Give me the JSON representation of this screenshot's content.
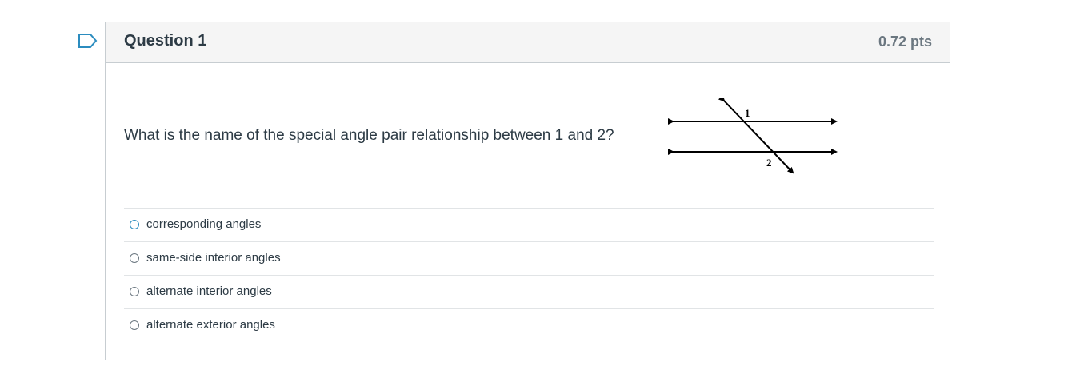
{
  "question": {
    "title": "Question 1",
    "points": "0.72 pts",
    "text": "What is the name of the special angle pair relationship between 1 and 2?",
    "diagram": {
      "angle_label_1": "1",
      "angle_label_2": "2"
    },
    "answers": [
      {
        "label": "corresponding angles",
        "selected": false
      },
      {
        "label": "same-side interior angles",
        "selected": false
      },
      {
        "label": "alternate interior angles",
        "selected": false
      },
      {
        "label": "alternate exterior angles",
        "selected": false
      }
    ]
  },
  "colors": {
    "header_bg": "#f5f5f5",
    "border": "#c7cdd1",
    "text": "#2d3b45",
    "points_text": "#6b7780",
    "focus_radio": "#2b8cbf",
    "flag_icon": "#2b8cbf"
  }
}
